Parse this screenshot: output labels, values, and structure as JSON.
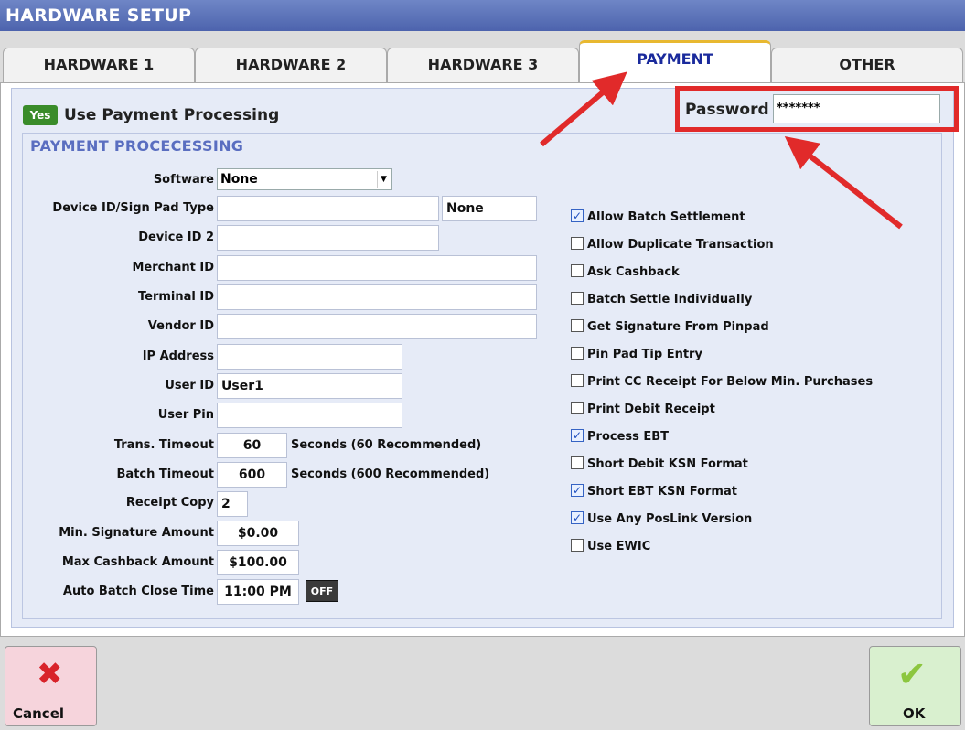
{
  "window": {
    "title": "HARDWARE SETUP"
  },
  "tabs": [
    {
      "label": "HARDWARE 1"
    },
    {
      "label": "HARDWARE 2"
    },
    {
      "label": "HARDWARE 3"
    },
    {
      "label": "PAYMENT",
      "active": true
    },
    {
      "label": "OTHER"
    }
  ],
  "payment": {
    "use_toggle": "Yes",
    "use_label": "Use Payment Processing",
    "password_label": "Password",
    "password_value": "*******",
    "group_title": "PAYMENT PROCECESSING",
    "fields": {
      "software": {
        "label": "Software",
        "value": "None"
      },
      "device_id": {
        "label": "Device ID/Sign Pad Type",
        "value": "",
        "type_value": "None"
      },
      "device_id2": {
        "label": "Device ID 2",
        "value": ""
      },
      "merchant_id": {
        "label": "Merchant ID",
        "value": ""
      },
      "terminal_id": {
        "label": "Terminal ID",
        "value": ""
      },
      "vendor_id": {
        "label": "Vendor ID",
        "value": ""
      },
      "ip_address": {
        "label": "IP Address",
        "value": ""
      },
      "user_id": {
        "label": "User ID",
        "value": "User1"
      },
      "user_pin": {
        "label": "User Pin",
        "value": ""
      },
      "trans_timeout": {
        "label": "Trans. Timeout",
        "value": "60",
        "suffix": "Seconds (60 Recommended)"
      },
      "batch_timeout": {
        "label": "Batch Timeout",
        "value": "600",
        "suffix": "Seconds (600 Recommended)"
      },
      "receipt_copy": {
        "label": "Receipt Copy",
        "value": "2"
      },
      "min_signature": {
        "label": "Min. Signature Amount",
        "value": "$0.00"
      },
      "max_cashback": {
        "label": "Max Cashback Amount",
        "value": "$100.00"
      },
      "auto_batch": {
        "label": "Auto Batch Close Time",
        "value": "11:00 PM",
        "toggle": "OFF"
      }
    },
    "options": [
      {
        "label": "Allow Batch Settlement",
        "checked": true
      },
      {
        "label": "Allow Duplicate Transaction",
        "checked": false
      },
      {
        "label": "Ask Cashback",
        "checked": false
      },
      {
        "label": "Batch Settle Individually",
        "checked": false
      },
      {
        "label": "Get Signature From Pinpad",
        "checked": false
      },
      {
        "label": "Pin Pad Tip Entry",
        "checked": false
      },
      {
        "label": "Print CC Receipt For Below Min. Purchases",
        "checked": false
      },
      {
        "label": "Print Debit Receipt",
        "checked": false
      },
      {
        "label": "Process EBT",
        "checked": true
      },
      {
        "label": "Short Debit KSN Format",
        "checked": false
      },
      {
        "label": "Short EBT KSN Format",
        "checked": true
      },
      {
        "label": "Use Any PosLink Version",
        "checked": true
      },
      {
        "label": "Use EWIC",
        "checked": false
      }
    ]
  },
  "actions": {
    "cancel_label": "Cancel",
    "ok_label": "OK"
  },
  "colors": {
    "title_bar": "#4d63ad",
    "active_tab_text": "#1a2a9c",
    "highlight": "#e12a2a",
    "yes_badge": "#3a8c2a"
  },
  "icons": {
    "cancel": "close-x-icon",
    "ok": "checkmark-icon"
  }
}
